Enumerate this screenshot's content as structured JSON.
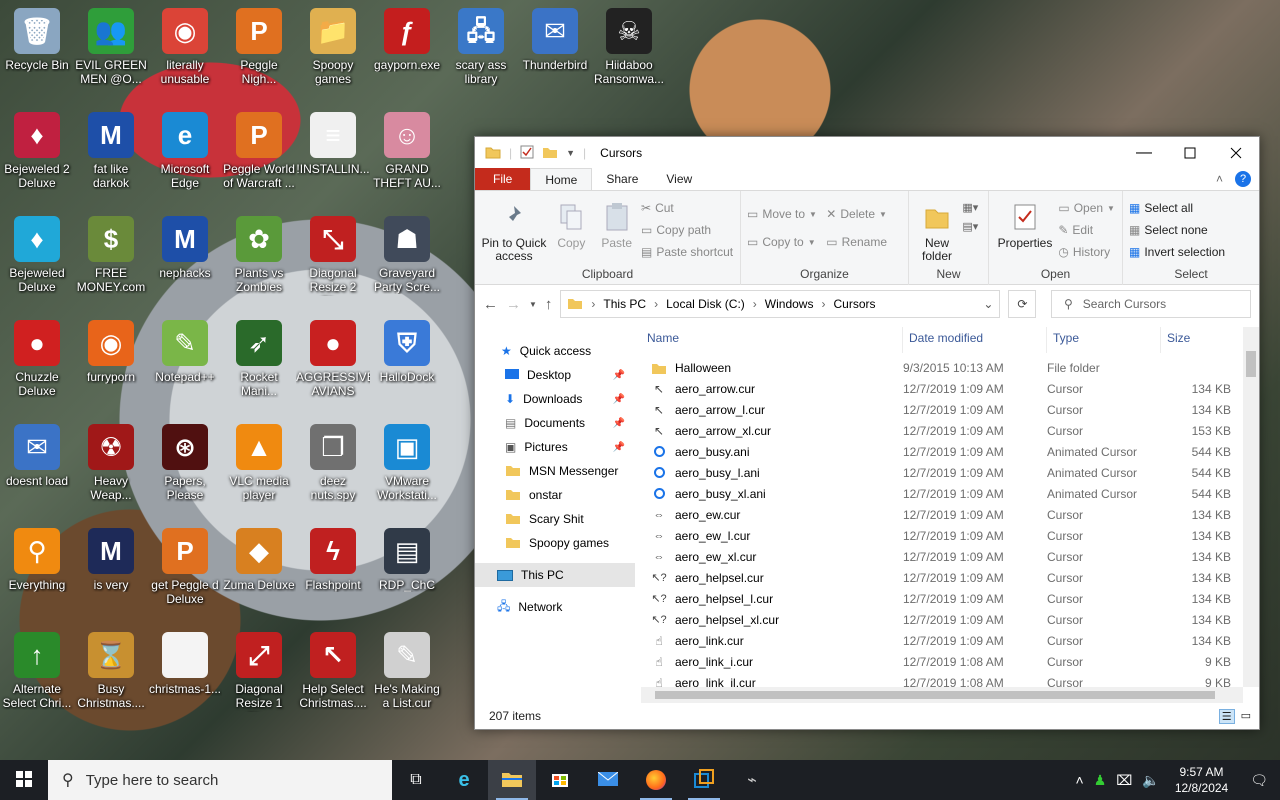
{
  "desktop": {
    "icons": [
      {
        "label": "Recycle Bin",
        "icon": "recycle-bin-icon",
        "color": "#8aa6c1",
        "glyph": "🗑"
      },
      {
        "label": "EVIL GREEN MEN @O...",
        "icon": "users-icon",
        "color": "#2f9e3a",
        "glyph": "👥"
      },
      {
        "label": "literally unusable",
        "icon": "chrome-icon",
        "color": "#db4437",
        "glyph": "◉"
      },
      {
        "label": "Peggle Nigh...",
        "icon": "peggle-icon",
        "color": "#e07020",
        "glyph": "P"
      },
      {
        "label": "Spoopy games",
        "icon": "folder-icon",
        "color": "#e0b050",
        "glyph": "📁"
      },
      {
        "label": "gayporn.exe",
        "icon": "flash-icon",
        "color": "#c41e1e",
        "glyph": "ƒ"
      },
      {
        "label": "scary ass library",
        "icon": "network-icon",
        "color": "#3a78c8",
        "glyph": "🖧"
      },
      {
        "label": "Thunderbird",
        "icon": "thunderbird-icon",
        "color": "#3b73c6",
        "glyph": "✉"
      },
      {
        "label": "Hiidaboo Ransomwa...",
        "icon": "ransomware-icon",
        "color": "#222",
        "glyph": "☠"
      },
      {
        "label": "Bejeweled 2 Deluxe",
        "icon": "bejeweled-icon",
        "color": "#c02040",
        "glyph": "♦"
      },
      {
        "label": "fat like darkok",
        "icon": "mpi-icon",
        "color": "#1e4fa8",
        "glyph": "M"
      },
      {
        "label": "Microsoft Edge",
        "icon": "edge-icon",
        "color": "#1a8ad4",
        "glyph": "e"
      },
      {
        "label": "Peggle World of Warcraft ...",
        "icon": "peggle-icon",
        "color": "#e07020",
        "glyph": "P"
      },
      {
        "label": "!INSTALLIN...",
        "icon": "document-icon",
        "color": "#f0f0f0",
        "glyph": "≡"
      },
      {
        "label": "GRAND THEFT AU...",
        "icon": "anime-icon",
        "color": "#d88aa0",
        "glyph": "☺"
      },
      {
        "label": "Bejeweled Deluxe",
        "icon": "bejeweled-icon",
        "color": "#20a8d8",
        "glyph": "♦"
      },
      {
        "label": "FREE MONEY.com",
        "icon": "money-icon",
        "color": "#6a8a3a",
        "glyph": "$"
      },
      {
        "label": "nephacks",
        "icon": "mpi-icon",
        "color": "#1e4fa8",
        "glyph": "M"
      },
      {
        "label": "Plants vs Zombies",
        "icon": "plant-icon",
        "color": "#5a9a3a",
        "glyph": "✿"
      },
      {
        "label": "Diagonal Resize 2 Ch...",
        "icon": "resize-icon",
        "color": "#c02020",
        "glyph": "⤡"
      },
      {
        "label": "Graveyard Party Scre...",
        "icon": "graveyard-icon",
        "color": "#404a5a",
        "glyph": "☗"
      },
      {
        "label": "Chuzzle Deluxe",
        "icon": "chuzzle-icon",
        "color": "#d02020",
        "glyph": "●"
      },
      {
        "label": "furryporn",
        "icon": "firefox-icon",
        "color": "#e8641a",
        "glyph": "◉"
      },
      {
        "label": "Notepad++",
        "icon": "notepad-icon",
        "color": "#7ab648",
        "glyph": "✎"
      },
      {
        "label": "Rocket Mani...",
        "icon": "rocket-icon",
        "color": "#2a6a2a",
        "glyph": "➶"
      },
      {
        "label": "AGGRESSIVE AVIANS",
        "icon": "angry-bird-icon",
        "color": "#c82020",
        "glyph": "●"
      },
      {
        "label": "HalloDock",
        "icon": "shield-icon",
        "color": "#3a7ad8",
        "glyph": "⛨"
      },
      {
        "label": "doesnt load",
        "icon": "thunderbird-icon",
        "color": "#3b73c6",
        "glyph": "✉"
      },
      {
        "label": "Heavy Weap...",
        "icon": "heavy-weapon-icon",
        "color": "#a01818",
        "glyph": "☢"
      },
      {
        "label": "Papers, Please",
        "icon": "papers-icon",
        "color": "#501010",
        "glyph": "⊛"
      },
      {
        "label": "VLC media player",
        "icon": "vlc-icon",
        "color": "#f08a10",
        "glyph": "▲"
      },
      {
        "label": "deez nuts.spy",
        "icon": "files-icon",
        "color": "#707070",
        "glyph": "❐"
      },
      {
        "label": "VMware Workstati...",
        "icon": "vmware-icon",
        "color": "#1a8ad4",
        "glyph": "▣"
      },
      {
        "label": "Everything",
        "icon": "search-icon",
        "color": "#f08a10",
        "glyph": "⚲"
      },
      {
        "label": "is very",
        "icon": "mpi-icon",
        "color": "#1e2a58",
        "glyph": "M"
      },
      {
        "label": "get Peggle d Deluxe",
        "icon": "peggle-icon",
        "color": "#e07020",
        "glyph": "P"
      },
      {
        "label": "Zuma Deluxe",
        "icon": "zuma-icon",
        "color": "#d88020",
        "glyph": "◆"
      },
      {
        "label": "Flashpoint",
        "icon": "flashpoint-icon",
        "color": "#c02020",
        "glyph": "ϟ"
      },
      {
        "label": "RDP_ChC",
        "icon": "rdp-icon",
        "color": "#303a48",
        "glyph": "▤"
      },
      {
        "label": "Alternate Select Chri...",
        "icon": "cursor-icon",
        "color": "#2a8a2a",
        "glyph": "↑"
      },
      {
        "label": "Busy Christmas....",
        "icon": "hourglass-icon",
        "color": "#c89030",
        "glyph": "⌛"
      },
      {
        "label": "christmas-1...",
        "icon": "file-icon",
        "color": "#f4f4f4",
        "glyph": " "
      },
      {
        "label": "Diagonal Resize 1 Ch...",
        "icon": "resize-icon",
        "color": "#c02020",
        "glyph": "⤢"
      },
      {
        "label": "Help Select Christmas....",
        "icon": "cursor-icon",
        "color": "#c02020",
        "glyph": "↖"
      },
      {
        "label": "He's Making a List.cur",
        "icon": "list-cursor-icon",
        "color": "#d0d0d0",
        "glyph": "✎"
      }
    ]
  },
  "explorer": {
    "title": "Cursors",
    "tabs": {
      "file": "File",
      "home": "Home",
      "share": "Share",
      "view": "View"
    },
    "ribbon": {
      "clipboard": {
        "group": "Clipboard",
        "pin": "Pin to Quick access",
        "copy": "Copy",
        "paste": "Paste",
        "cut": "Cut",
        "copy_path": "Copy path",
        "paste_shortcut": "Paste shortcut"
      },
      "organize": {
        "group": "Organize",
        "move_to": "Move to",
        "copy_to": "Copy to",
        "delete": "Delete",
        "rename": "Rename"
      },
      "new": {
        "group": "New",
        "new_folder": "New folder"
      },
      "open": {
        "group": "Open",
        "properties": "Properties",
        "open": "Open",
        "edit": "Edit",
        "history": "History"
      },
      "select": {
        "group": "Select",
        "select_all": "Select all",
        "select_none": "Select none",
        "invert": "Invert selection"
      }
    },
    "address": {
      "crumbs": [
        "This PC",
        "Local Disk (C:)",
        "Windows",
        "Cursors"
      ],
      "search_placeholder": "Search Cursors"
    },
    "nav": {
      "quick_access": "Quick access",
      "pinned": [
        {
          "label": "Desktop",
          "icon": "desktop-icon",
          "pinned": true
        },
        {
          "label": "Downloads",
          "icon": "downloads-icon",
          "pinned": true
        },
        {
          "label": "Documents",
          "icon": "documents-icon",
          "pinned": true
        },
        {
          "label": "Pictures",
          "icon": "pictures-icon",
          "pinned": true
        },
        {
          "label": "MSN Messenger",
          "icon": "folder-icon",
          "pinned": false
        },
        {
          "label": "onstar",
          "icon": "folder-icon",
          "pinned": false
        },
        {
          "label": "Scary Shit",
          "icon": "folder-icon",
          "pinned": false
        },
        {
          "label": "Spoopy games",
          "icon": "folder-icon",
          "pinned": false
        }
      ],
      "this_pc": "This PC",
      "network": "Network"
    },
    "columns": {
      "name": "Name",
      "date": "Date modified",
      "type": "Type",
      "size": "Size"
    },
    "files": [
      {
        "name": "Halloween",
        "date": "9/3/2015 10:13 AM",
        "type": "File folder",
        "size": "",
        "icon": "folder-icon"
      },
      {
        "name": "aero_arrow.cur",
        "date": "12/7/2019 1:09 AM",
        "type": "Cursor",
        "size": "134 KB",
        "icon": "arrow-cursor-icon"
      },
      {
        "name": "aero_arrow_l.cur",
        "date": "12/7/2019 1:09 AM",
        "type": "Cursor",
        "size": "134 KB",
        "icon": "arrow-cursor-icon"
      },
      {
        "name": "aero_arrow_xl.cur",
        "date": "12/7/2019 1:09 AM",
        "type": "Cursor",
        "size": "153 KB",
        "icon": "arrow-cursor-icon"
      },
      {
        "name": "aero_busy.ani",
        "date": "12/7/2019 1:09 AM",
        "type": "Animated Cursor",
        "size": "544 KB",
        "icon": "busy-cursor-icon"
      },
      {
        "name": "aero_busy_l.ani",
        "date": "12/7/2019 1:09 AM",
        "type": "Animated Cursor",
        "size": "544 KB",
        "icon": "busy-cursor-icon"
      },
      {
        "name": "aero_busy_xl.ani",
        "date": "12/7/2019 1:09 AM",
        "type": "Animated Cursor",
        "size": "544 KB",
        "icon": "busy-cursor-icon"
      },
      {
        "name": "aero_ew.cur",
        "date": "12/7/2019 1:09 AM",
        "type": "Cursor",
        "size": "134 KB",
        "icon": "ew-resize-cursor-icon"
      },
      {
        "name": "aero_ew_l.cur",
        "date": "12/7/2019 1:09 AM",
        "type": "Cursor",
        "size": "134 KB",
        "icon": "ew-resize-cursor-icon"
      },
      {
        "name": "aero_ew_xl.cur",
        "date": "12/7/2019 1:09 AM",
        "type": "Cursor",
        "size": "134 KB",
        "icon": "ew-resize-cursor-icon"
      },
      {
        "name": "aero_helpsel.cur",
        "date": "12/7/2019 1:09 AM",
        "type": "Cursor",
        "size": "134 KB",
        "icon": "help-cursor-icon"
      },
      {
        "name": "aero_helpsel_l.cur",
        "date": "12/7/2019 1:09 AM",
        "type": "Cursor",
        "size": "134 KB",
        "icon": "help-cursor-icon"
      },
      {
        "name": "aero_helpsel_xl.cur",
        "date": "12/7/2019 1:09 AM",
        "type": "Cursor",
        "size": "134 KB",
        "icon": "help-cursor-icon"
      },
      {
        "name": "aero_link.cur",
        "date": "12/7/2019 1:09 AM",
        "type": "Cursor",
        "size": "134 KB",
        "icon": "hand-cursor-icon"
      },
      {
        "name": "aero_link_i.cur",
        "date": "12/7/2019 1:08 AM",
        "type": "Cursor",
        "size": "9 KB",
        "icon": "hand-cursor-icon"
      },
      {
        "name": "aero_link_il.cur",
        "date": "12/7/2019 1:08 AM",
        "type": "Cursor",
        "size": "9 KB",
        "icon": "hand-cursor-icon"
      }
    ],
    "status": "207 items"
  },
  "taskbar": {
    "search_placeholder": "Type here to search",
    "time": "9:57 AM",
    "date": "12/8/2024"
  },
  "colors": {
    "accent": "#0078d7",
    "file_tab": "#c42b1c",
    "taskbar": "#1c1f24",
    "folder": "#f1c75b"
  }
}
